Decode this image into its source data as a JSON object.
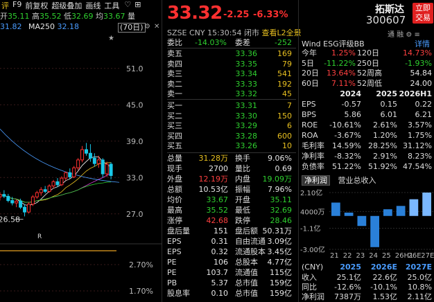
{
  "toolbar": {
    "items": [
      "评",
      "F9",
      "前复权",
      "超级叠加",
      "画线",
      "工具"
    ],
    "icons": [
      "heart-icon",
      "grid-icon"
    ]
  },
  "ohlc": {
    "open_label": "开",
    "open": "35.11",
    "high_label": "高",
    "high": "35.52",
    "low_label": "低",
    "low": "32.69",
    "avg_label": "均",
    "avg": "33.67",
    "vol_label": "量"
  },
  "ma": {
    "ma_prev": "31.82",
    "ma250_label": "MA250",
    "ma250": "32.18"
  },
  "period_button": "(70日)",
  "chart_data": {
    "type": "candlestick",
    "y_ticks": [
      "51.0",
      "45.0",
      "39.0",
      "33.0",
      "27.0"
    ],
    "y_ticks_lower": [
      "2.70%",
      "1.70%"
    ],
    "ylim": [
      24,
      56
    ],
    "annotations": [
      "26.58",
      "R"
    ],
    "candles": [
      {
        "o": 29.8,
        "h": 30.6,
        "l": 29.2,
        "c": 30.2
      },
      {
        "o": 30.2,
        "h": 30.9,
        "l": 29.6,
        "c": 29.9
      },
      {
        "o": 29.9,
        "h": 30.3,
        "l": 28.9,
        "c": 29.2
      },
      {
        "o": 29.2,
        "h": 29.8,
        "l": 28.4,
        "c": 28.8
      },
      {
        "o": 28.8,
        "h": 29.4,
        "l": 28.1,
        "c": 29.1
      },
      {
        "o": 29.1,
        "h": 29.5,
        "l": 27.8,
        "c": 28.1
      },
      {
        "o": 28.1,
        "h": 28.6,
        "l": 26.58,
        "c": 27.3
      },
      {
        "o": 27.3,
        "h": 28.9,
        "l": 27.1,
        "c": 28.6
      },
      {
        "o": 28.6,
        "h": 30.1,
        "l": 28.3,
        "c": 29.8
      },
      {
        "o": 29.8,
        "h": 30.8,
        "l": 29.5,
        "c": 30.5
      },
      {
        "o": 30.5,
        "h": 31.4,
        "l": 30.0,
        "c": 31.0
      },
      {
        "o": 31.0,
        "h": 31.6,
        "l": 30.4,
        "c": 30.7
      },
      {
        "o": 30.7,
        "h": 31.9,
        "l": 30.5,
        "c": 31.6
      },
      {
        "o": 31.6,
        "h": 32.6,
        "l": 31.2,
        "c": 32.3
      },
      {
        "o": 32.3,
        "h": 32.9,
        "l": 31.4,
        "c": 31.8
      },
      {
        "o": 31.8,
        "h": 33.2,
        "l": 31.6,
        "c": 32.9
      },
      {
        "o": 32.9,
        "h": 34.0,
        "l": 32.5,
        "c": 33.8
      },
      {
        "o": 33.8,
        "h": 34.5,
        "l": 32.8,
        "c": 33.1
      },
      {
        "o": 33.1,
        "h": 34.9,
        "l": 32.9,
        "c": 34.6
      },
      {
        "o": 34.6,
        "h": 36.2,
        "l": 34.2,
        "c": 35.9
      },
      {
        "o": 35.9,
        "h": 38.2,
        "l": 35.5,
        "c": 37.6
      },
      {
        "o": 37.6,
        "h": 38.7,
        "l": 36.6,
        "c": 37.0
      },
      {
        "o": 37.0,
        "h": 38.5,
        "l": 35.6,
        "c": 36.2
      },
      {
        "o": 36.2,
        "h": 37.0,
        "l": 34.8,
        "c": 35.3
      },
      {
        "o": 35.3,
        "h": 36.6,
        "l": 34.6,
        "c": 35.9
      },
      {
        "o": 35.9,
        "h": 36.2,
        "l": 33.0,
        "c": 33.6
      },
      {
        "o": 33.6,
        "h": 35.6,
        "l": 33.1,
        "c": 35.2
      },
      {
        "o": 35.2,
        "h": 35.52,
        "l": 32.69,
        "c": 33.32
      }
    ]
  },
  "quote": {
    "price": "33.32",
    "change": "-2.25",
    "pct": "-6.33%",
    "market": "SZSE",
    "currency": "CNY",
    "time": "15:30:54",
    "status": "闭市",
    "level2_link": "查看L2全景",
    "weibi_label": "委比",
    "weibi": "-14.03%",
    "weicha_label": "委差",
    "weicha": "-252",
    "asks": [
      {
        "label": "卖五",
        "price": "33.36",
        "vol": "169"
      },
      {
        "label": "卖四",
        "price": "33.35",
        "vol": "79"
      },
      {
        "label": "卖三",
        "price": "33.34",
        "vol": "541"
      },
      {
        "label": "卖二",
        "price": "33.33",
        "vol": "192"
      },
      {
        "label": "卖一",
        "price": "33.32",
        "vol": "45"
      }
    ],
    "bids": [
      {
        "label": "买一",
        "price": "33.31",
        "vol": "7"
      },
      {
        "label": "买二",
        "price": "33.30",
        "vol": "150"
      },
      {
        "label": "买三",
        "price": "33.29",
        "vol": "6"
      },
      {
        "label": "买四",
        "price": "33.28",
        "vol": "600"
      },
      {
        "label": "买五",
        "price": "33.26",
        "vol": "10"
      }
    ],
    "stats": [
      {
        "l1": "总量",
        "v1": "31.28万",
        "c1": "y",
        "l2": "换手",
        "v2": "9.06%",
        "c2": "w"
      },
      {
        "l1": "现手",
        "v1": "2700",
        "c1": "w",
        "l2": "量比",
        "v2": "0.69",
        "c2": "w"
      },
      {
        "l1": "外盘",
        "v1": "12.19万",
        "c1": "r",
        "l2": "内盘",
        "v2": "19.09万",
        "c2": "g"
      },
      {
        "l1": "总额",
        "v1": "10.53亿",
        "c1": "w",
        "l2": "振幅",
        "v2": "7.96%",
        "c2": "w"
      },
      {
        "l1": "均价",
        "v1": "33.67",
        "c1": "g",
        "l2": "开盘",
        "v2": "35.11",
        "c2": "g"
      },
      {
        "l1": "最高",
        "v1": "35.52",
        "c1": "g",
        "l2": "最低",
        "v2": "32.69",
        "c2": "g"
      },
      {
        "l1": "涨停",
        "v1": "42.68",
        "c1": "r",
        "l2": "跌停",
        "v2": "28.46",
        "c2": "g"
      },
      {
        "l1": "盘后量",
        "v1": "151",
        "c1": "w",
        "l2": "盘后额",
        "v2": "50.31万",
        "c2": "w"
      },
      {
        "l1": "EPS",
        "v1": "0.31",
        "c1": "w",
        "l2": "自由流通",
        "v2": "3.09亿",
        "c2": "w"
      },
      {
        "l1": "EPS",
        "v1": "0.32",
        "c1": "w",
        "l2": "流通股本",
        "v2": "3.45亿",
        "c2": "w"
      },
      {
        "l1": "PE",
        "v1": "106",
        "c1": "w",
        "l2": "总股本",
        "v2": "4.77亿",
        "c2": "w"
      },
      {
        "l1": "PE",
        "v1": "103.7",
        "c1": "w",
        "l2": "流通值",
        "v2": "115亿",
        "c2": "w"
      },
      {
        "l1": "PB",
        "v1": "5.37",
        "c1": "w",
        "l2": "总市值",
        "v2": "159亿",
        "c2": "w"
      },
      {
        "l1": "股息率",
        "v1": "0.10",
        "c1": "w",
        "l2": "总市值",
        "v2": "159亿",
        "c2": "w"
      }
    ]
  },
  "stock": {
    "name": "拓斯达",
    "code": "300607",
    "buy_button": [
      "立即",
      "交易"
    ],
    "icons_label": "通 融",
    "esg": "Wind ESG评级BB",
    "detail": "详情",
    "periods": [
      {
        "a": "今年",
        "av": "1.25%",
        "ac": "r",
        "b": "120日",
        "bv": "14.73%",
        "bc": "r"
      },
      {
        "a": "5日",
        "av": "-11.22%",
        "ac": "g",
        "b": "250日",
        "bv": "-1.93%",
        "bc": "g"
      },
      {
        "a": "20日",
        "av": "13.64%",
        "ac": "r",
        "b": "52周高",
        "bv": "54.84",
        "bc": "w"
      },
      {
        "a": "60日",
        "av": "7.11%",
        "ac": "r",
        "b": "52周低",
        "bv": "24.00",
        "bc": "w"
      }
    ],
    "fin_head": [
      "2024",
      "2025",
      "2026H1"
    ],
    "fin": [
      {
        "n": "EPS",
        "c1": "-0.57",
        "c2": "0.15",
        "c3": "0.22"
      },
      {
        "n": "BPS",
        "c1": "5.86",
        "c2": "6.01",
        "c3": "6.21"
      },
      {
        "n": "ROE",
        "c1": "-10.61%",
        "c2": "2.61%",
        "c3": "3.57%"
      },
      {
        "n": "ROA",
        "c1": "-3.67%",
        "c2": "1.20%",
        "c3": "1.75%"
      },
      {
        "n": "毛利率",
        "c1": "14.59%",
        "c2": "28.25%",
        "c3": "31.12%"
      },
      {
        "n": "净利率",
        "c1": "-8.32%",
        "c2": "2.91%",
        "c3": "8.23%"
      },
      {
        "n": "负债率",
        "c1": "51.22%",
        "c2": "51.92%",
        "c3": "47.54%"
      }
    ],
    "tabs": [
      "净利润",
      "营业总收入"
    ],
    "bar_chart": {
      "y_ticks": [
        "2.10亿",
        "4000万",
        "-1.1亿",
        "-3.00亿"
      ],
      "x_ticks": [
        "21",
        "22",
        "23",
        "24",
        "25",
        "26H1",
        "26E",
        "27E"
      ],
      "values": [
        1.2,
        0.3,
        -0.9,
        -2.8,
        0.6,
        0.9,
        1.5,
        2.1
      ]
    },
    "forecast_head": [
      "(CNY)",
      "2025",
      "2026E",
      "2027E"
    ],
    "forecast": [
      {
        "n": "收入",
        "c1": "25.1亿",
        "c2": "22.6亿",
        "c3": "25.0亿",
        "cc1": "w",
        "cc2": "w",
        "cc3": "w"
      },
      {
        "n": "同比",
        "c1": "-12.6%",
        "c2": "-10.1%",
        "c3": "10.8%",
        "cc1": "g",
        "cc2": "g",
        "cc3": "r"
      },
      {
        "n": "净利润",
        "c1": "7387万",
        "c2": "1.53亿",
        "c3": "2.11亿",
        "cc1": "w",
        "cc2": "w",
        "cc3": "w"
      }
    ]
  }
}
